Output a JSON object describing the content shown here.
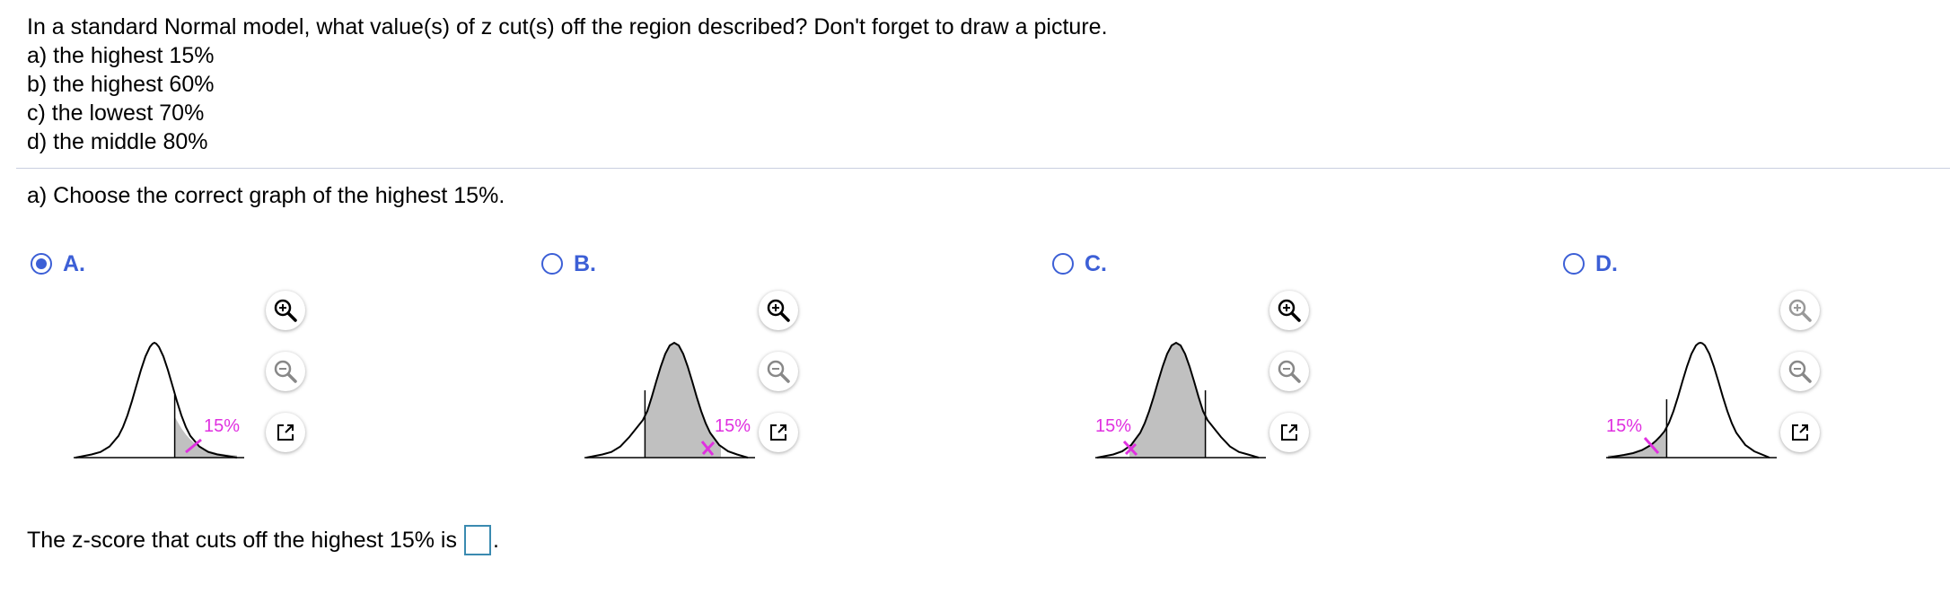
{
  "question": {
    "stem": "In a standard Normal model, what value(s) of z cut(s) off the region described? Don't forget to draw a picture.",
    "parts": [
      "a) the highest 15%",
      "b) the highest 60%",
      "c) the lowest 70%",
      "d) the middle 80%"
    ]
  },
  "prompt": "a) Choose the correct graph of the highest 15%.",
  "options": [
    {
      "letter": "A.",
      "selected": true,
      "label": "15%",
      "shaded_region": "upper 15% tail"
    },
    {
      "letter": "B.",
      "selected": false,
      "label": "15%",
      "shaded_region": "between cutoffs, upper 15% unshaded"
    },
    {
      "letter": "C.",
      "selected": false,
      "label": "15%",
      "shaded_region": "between cutoffs, lower 15% unshaded"
    },
    {
      "letter": "D.",
      "selected": false,
      "label": "15%",
      "shaded_region": "lower 15% tail"
    }
  ],
  "tools": [
    "zoom-in-icon",
    "zoom-out-icon",
    "popout-icon"
  ],
  "answer": {
    "text": "The z-score that cuts off the highest 15% is",
    "value": "",
    "suffix": "."
  },
  "colors": {
    "accent": "#3c5fd6",
    "label": "#e030e0",
    "shade": "#c0c0c0",
    "answer_box_border": "#3a8ab0"
  }
}
